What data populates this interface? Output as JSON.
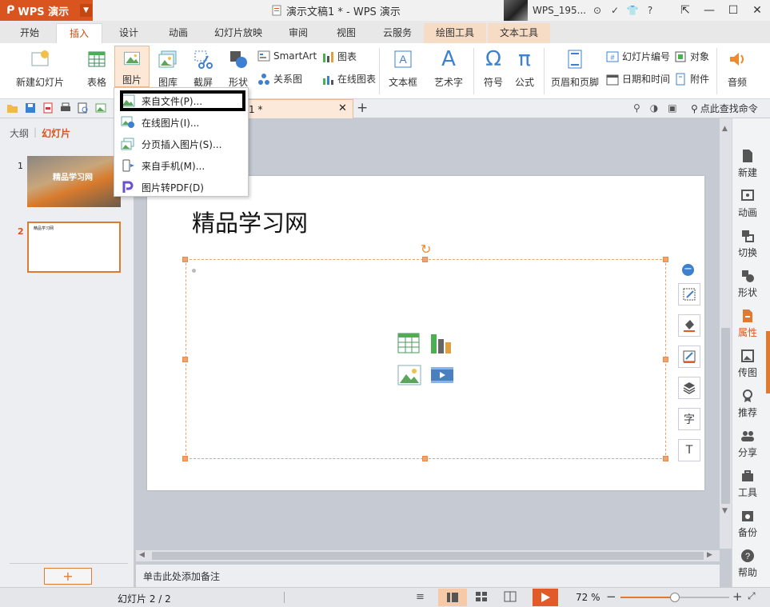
{
  "app": {
    "name": "WPS 演示"
  },
  "window": {
    "doc_title": "演示文稿1 * - WPS 演示",
    "username": "WPS_195..."
  },
  "tabs": [
    "开始",
    "插入",
    "设计",
    "动画",
    "幻灯片放映",
    "审阅",
    "视图",
    "云服务",
    "绘图工具",
    "文本工具"
  ],
  "ribbon": {
    "new_slide": "新建幻灯片",
    "table": "表格",
    "picture": "图片",
    "gallery": "图库",
    "screenshot": "截屏",
    "shape": "形状",
    "smartart": "SmartArt",
    "relation": "关系图",
    "chart": "图表",
    "online_chart": "在线图表",
    "textbox": "文本框",
    "wordart": "艺术字",
    "symbol": "符号",
    "formula": "公式",
    "header_footer": "页眉和页脚",
    "slide_number": "幻灯片编号",
    "object": "对象",
    "datetime": "日期和时间",
    "attachment": "附件",
    "audio": "音频",
    "symbol_glyph": "Ω",
    "formula_glyph": "π",
    "wordart_glyph": "A"
  },
  "doc_tab": {
    "label": "1 *"
  },
  "search": {
    "label": "点此查找命令"
  },
  "picture_menu": [
    "来自文件(P)...",
    "在线图片(I)...",
    "分页插入图片(S)...",
    "来自手机(M)...",
    "图片转PDF(D)"
  ],
  "left_panel": {
    "tab_outline": "大纲",
    "tab_slides": "幻灯片",
    "slides": [
      {
        "number": "1",
        "title": "精品学习网"
      },
      {
        "number": "2",
        "title": "精品学习网"
      }
    ]
  },
  "slide": {
    "title": "精品学习网"
  },
  "notes": {
    "placeholder": "单击此处添加备注"
  },
  "right_sidebar": [
    "新建",
    "动画",
    "切换",
    "形状",
    "属性",
    "传图",
    "推荐",
    "分享",
    "工具",
    "备份",
    "帮助"
  ],
  "status": {
    "slide_position": "幻灯片 2 / 2",
    "zoom": "72 %",
    "zoom_fraction": 0.5
  },
  "colors": {
    "accent": "#d9541f",
    "selection": "#f3a36a",
    "ribbon_blue": "#3d7fd0"
  }
}
